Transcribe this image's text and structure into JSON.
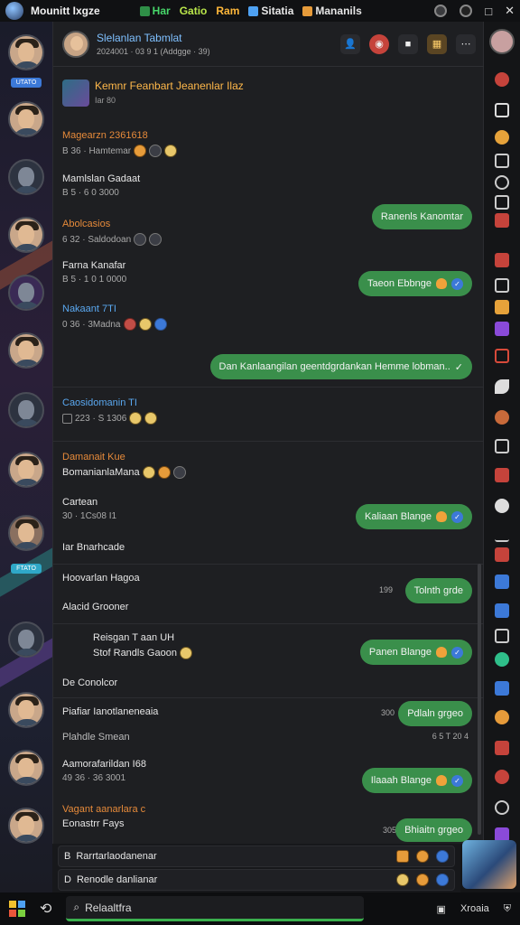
{
  "app": {
    "title": "Mounitt Ixgze"
  },
  "menu": [
    {
      "label": "Har",
      "color": "#47d76a"
    },
    {
      "label": "Gatio",
      "color": "#b9e64a"
    },
    {
      "label": "Ram",
      "color": "#ffb83a"
    },
    {
      "label": "Sitatia",
      "color": "#e6e6e6"
    },
    {
      "label": "Mananils",
      "color": "#e6e6e6"
    }
  ],
  "window_controls": {
    "minimize": "−",
    "maximize": "□",
    "close": "✕"
  },
  "left_avatars": [
    {
      "kind": "person",
      "tag": "UTATO"
    },
    {
      "kind": "person"
    },
    {
      "kind": "robot"
    },
    {
      "kind": "person"
    },
    {
      "kind": "robot"
    },
    {
      "kind": "person"
    },
    {
      "kind": "robot"
    },
    {
      "kind": "person"
    },
    {
      "kind": "person",
      "tag": "FTATO"
    },
    {
      "kind": "robot"
    },
    {
      "kind": "person"
    },
    {
      "kind": "person"
    },
    {
      "kind": "person"
    }
  ],
  "chat": {
    "header": {
      "title": "Slelanlan Tabmlat",
      "subtitle": "2024001 · 03 9 1 (Addgge · 39)"
    },
    "pinned": {
      "title": "Kemnr Feanbart Jeanenlar Ilaz",
      "sub": "Iar 80"
    },
    "messages": [
      {
        "name": "Magearzn 2361618",
        "name_color": "#e68a3a",
        "line": "B 36 · Hamtemar"
      },
      {
        "name": "Mamlslan Gadaat",
        "name_color": "#e6e6e6",
        "line": "B 5 · 6 0 3000"
      },
      {
        "name": "Abolcasios",
        "name_color": "#e68a3a",
        "line": "6 32 · Saldodoan"
      },
      {
        "name": "Farna Kanafar",
        "name_color": "#e6e6e6",
        "line": "B 5 · 1 0 1 0000"
      },
      {
        "name": "Nakaant 7TI",
        "name_color": "#5aa8f0",
        "line": "0 36 · 3Madna"
      },
      {
        "name": "Caosidomanin TI",
        "name_color": "#5aa8f0",
        "line": "223 · S 1306"
      },
      {
        "name": "Damanait Kue",
        "name_color": "#e68a3a",
        "line": "BomanianlaMana"
      },
      {
        "name": "Cartean",
        "name_color": "#e6e6e6",
        "line": "30 · 1Cs08  I1"
      },
      {
        "name": "Iar Bnarhcade",
        "name_color": "#e6e6e6",
        "line": ""
      },
      {
        "name": "Hoovarlan Hagoa",
        "name_color": "#e6e6e6",
        "line": ""
      },
      {
        "name": "Alacid Grooner",
        "name_color": "#e6e6e6",
        "line": ""
      },
      {
        "name": "Reisgan T aan UH",
        "name_color": "#e6e6e6",
        "line": "Stof Randls Gaoon"
      },
      {
        "name": "De Conolcor",
        "name_color": "#e6e6e6",
        "line": ""
      },
      {
        "name": "Piafiar Ianotlaneneaia",
        "name_color": "#e6e6e6",
        "line": ""
      },
      {
        "name": "Plahdle Smean",
        "name_color": "#e6e6e6",
        "line": ""
      },
      {
        "name": "Aamorafarildan I68",
        "name_color": "#e6e6e6",
        "line": "49 36 · 36 3001"
      },
      {
        "name": "Vagant aanarlara c",
        "name_color": "#e68a3a",
        "line": "Eonastrr Fays"
      }
    ],
    "bubbles": [
      {
        "text": "Ranenls Kanomtar",
        "icon": ""
      },
      {
        "text": "Taeon Ebbnge",
        "icon": "fire-check"
      },
      {
        "text": "Dan Kanlaangilan geentdgrdankan Hemme lobman..",
        "icon": "check"
      },
      {
        "text": "Kaliaan Blange",
        "icon": "fire-check"
      },
      {
        "text": "Tolnth grde",
        "icon": "",
        "time": "199"
      },
      {
        "text": "Panen Blange",
        "icon": "fire-check"
      },
      {
        "text": "Pdlaln grgeo",
        "icon": "",
        "time": "300",
        "below": "6 5 T 20 4"
      },
      {
        "text": "Ilaaah Blange",
        "icon": "fire-check"
      },
      {
        "text": "Bhiaitn grgeo",
        "icon": "",
        "time": "305"
      }
    ]
  },
  "inputs": [
    {
      "text": "Rarrtarlaodanenar",
      "prefix": "B"
    },
    {
      "text": "Renodle danlianar",
      "prefix": "D"
    }
  ],
  "taskbar": {
    "search": "Relaaltfra",
    "right_label": "Xroaia"
  }
}
